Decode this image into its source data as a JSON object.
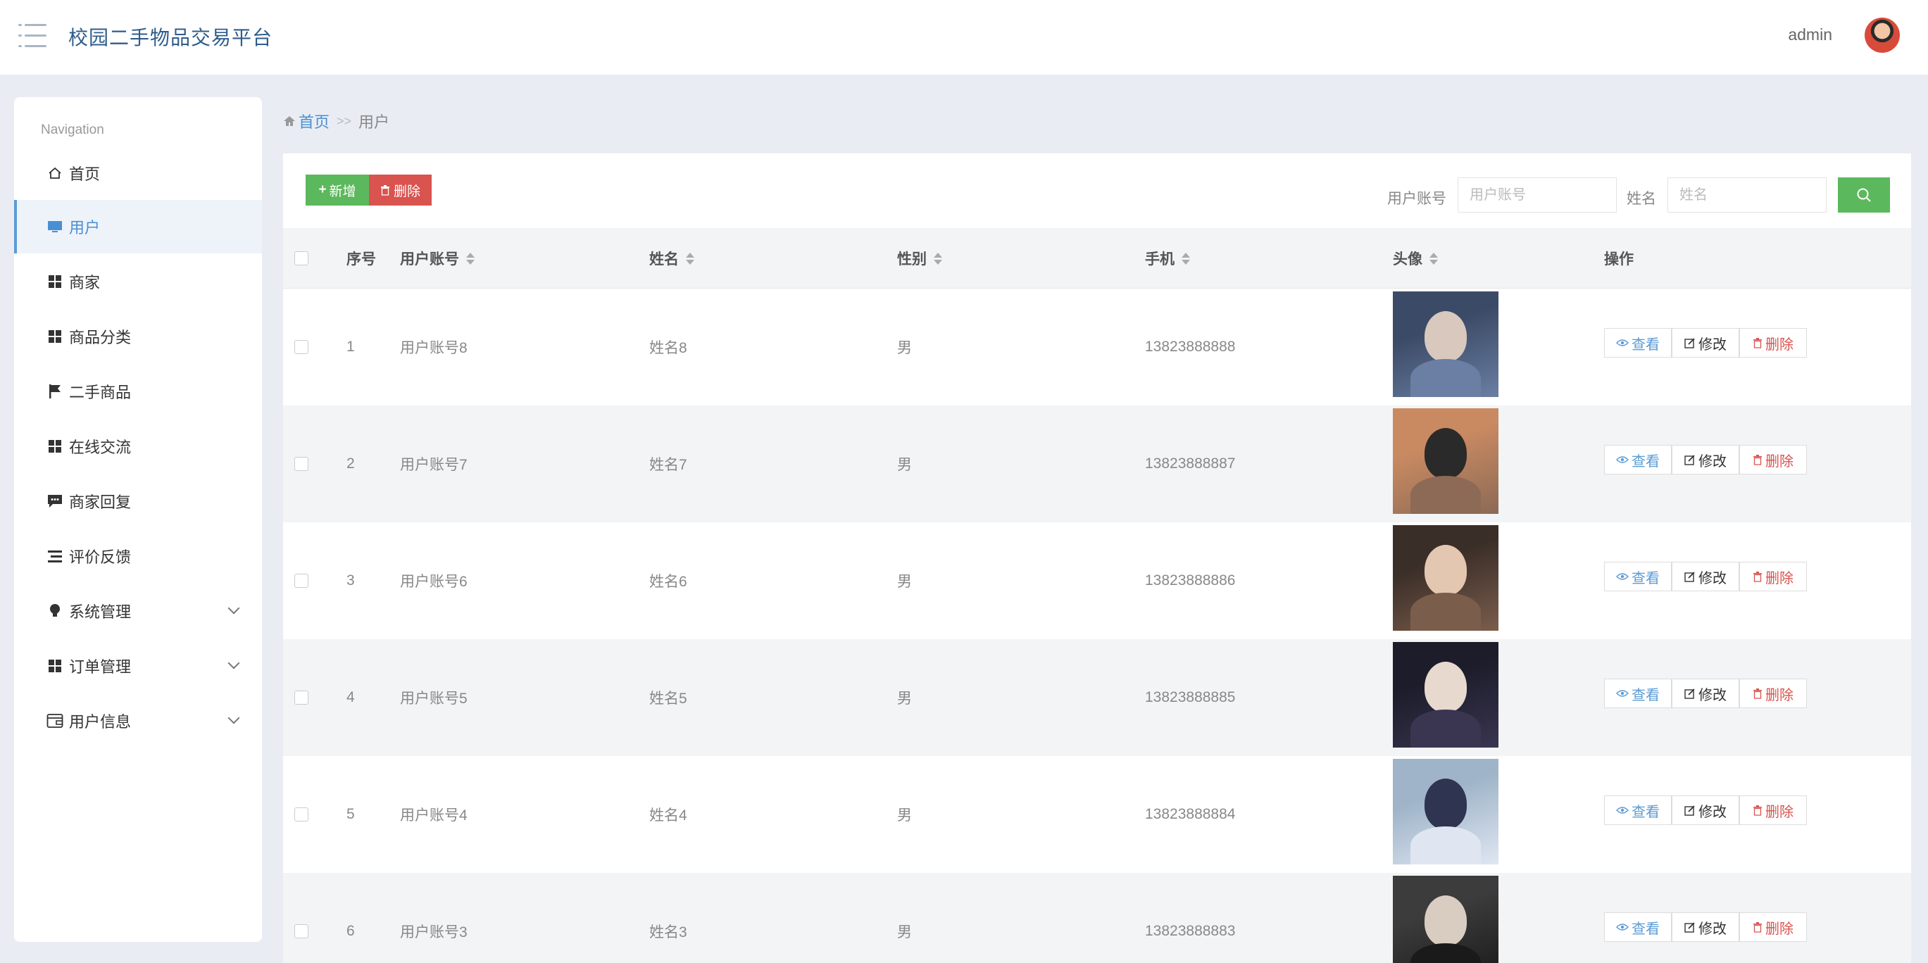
{
  "header": {
    "app_title": "校园二手物品交易平台",
    "user_name": "admin"
  },
  "sidebar": {
    "caption": "Navigation",
    "items": [
      {
        "label": "首页",
        "icon": "home-icon"
      },
      {
        "label": "用户",
        "icon": "monitor-icon",
        "active": true
      },
      {
        "label": "商家",
        "icon": "grid-icon"
      },
      {
        "label": "商品分类",
        "icon": "grid-icon"
      },
      {
        "label": "二手商品",
        "icon": "flag-icon"
      },
      {
        "label": "在线交流",
        "icon": "grid-icon"
      },
      {
        "label": "商家回复",
        "icon": "comment-icon"
      },
      {
        "label": "评价反馈",
        "icon": "list-icon"
      },
      {
        "label": "系统管理",
        "icon": "lightbulb-icon",
        "expandable": true
      },
      {
        "label": "订单管理",
        "icon": "grid-icon",
        "expandable": true
      },
      {
        "label": "用户信息",
        "icon": "wallet-icon",
        "expandable": true
      }
    ]
  },
  "breadcrumb": {
    "home": "首页",
    "separator": ">>",
    "current": "用户"
  },
  "toolbar": {
    "add_label": "新增",
    "delete_label": "删除",
    "account_label": "用户账号",
    "account_placeholder": "用户账号",
    "name_label": "姓名",
    "name_placeholder": "姓名"
  },
  "table": {
    "columns": [
      "序号",
      "用户账号",
      "姓名",
      "性别",
      "手机",
      "头像",
      "操作"
    ],
    "rows": [
      {
        "index": "1",
        "account": "用户账号8",
        "name": "姓名8",
        "gender": "男",
        "phone": "13823888888",
        "avatar_colors": [
          "#3b4a66",
          "#d8c8bd",
          "#6a7fa3"
        ]
      },
      {
        "index": "2",
        "account": "用户账号7",
        "name": "姓名7",
        "gender": "男",
        "phone": "13823888887",
        "avatar_colors": [
          "#c98a62",
          "#2a2a2a",
          "#8c6a55"
        ]
      },
      {
        "index": "3",
        "account": "用户账号6",
        "name": "姓名6",
        "gender": "男",
        "phone": "13823888886",
        "avatar_colors": [
          "#3a2e28",
          "#e4c7b0",
          "#7b5d4c"
        ]
      },
      {
        "index": "4",
        "account": "用户账号5",
        "name": "姓名5",
        "gender": "男",
        "phone": "13823888885",
        "avatar_colors": [
          "#1c1c2a",
          "#e8d9cf",
          "#3a3550"
        ]
      },
      {
        "index": "5",
        "account": "用户账号4",
        "name": "姓名4",
        "gender": "男",
        "phone": "13823888884",
        "avatar_colors": [
          "#9fb4c8",
          "#2f3450",
          "#dfe6f2"
        ]
      },
      {
        "index": "6",
        "account": "用户账号3",
        "name": "姓名3",
        "gender": "男",
        "phone": "13823888883",
        "avatar_colors": [
          "#3c3c3c",
          "#d9cdc2",
          "#1a1a1a"
        ]
      }
    ],
    "actions": {
      "view": "查看",
      "edit": "修改",
      "delete": "删除"
    }
  },
  "colors": {
    "accent": "#4a8fd4",
    "success": "#5cb85c",
    "danger": "#d9534f",
    "background": "#e9edf3"
  }
}
